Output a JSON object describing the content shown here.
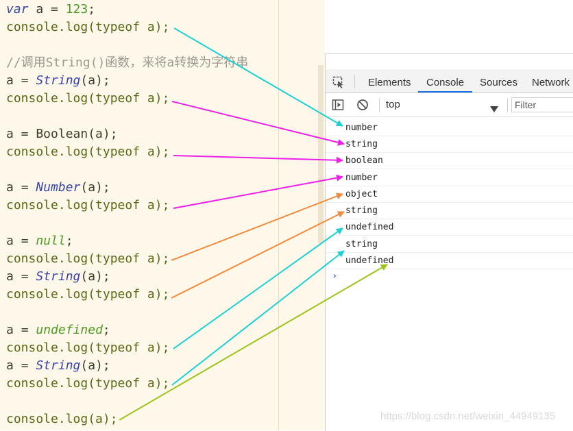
{
  "code": {
    "line1": {
      "kw": "var",
      "rest1": " a ",
      "op": "=",
      "num": " 123",
      "end": ";"
    },
    "line2": {
      "fn": "console.log(typeof a);"
    },
    "line3": {
      "comment": "//调用String()函数，来将a转换为字符串"
    },
    "line4": {
      "a": "a ",
      "eq": "= ",
      "cls": "String",
      "args": "(a);"
    },
    "line5": {
      "fn": "console.log(typeof a);"
    },
    "line6": {
      "text": "a = Boolean(a);"
    },
    "line7": {
      "fn": "console.log(typeof a);"
    },
    "line8": {
      "a": "a ",
      "eq": "= ",
      "cls": "Number",
      "args": "(a);"
    },
    "line9": {
      "fn": "console.log(typeof a);"
    },
    "line10": {
      "a": "a ",
      "eq": "= ",
      "kwv": "null",
      "end": ";"
    },
    "line11": {
      "fn": "console.log(typeof a);"
    },
    "line12": {
      "a": "a ",
      "eq": "= ",
      "cls": "String",
      "args": "(a);"
    },
    "line13": {
      "fn": "console.log(typeof a);"
    },
    "line14": {
      "a": "a ",
      "eq": "= ",
      "kwv": "undefined",
      "end": ";"
    },
    "line15": {
      "fn": "console.log(typeof a);"
    },
    "line16": {
      "a": "a ",
      "eq": "= ",
      "cls": "String",
      "args": "(a);"
    },
    "line17": {
      "fn": "console.log(typeof a);"
    },
    "line18": {
      "fn": "console.log(a);"
    }
  },
  "devtools": {
    "tabs": [
      "Elements",
      "Console",
      "Sources",
      "Network"
    ],
    "active_tab": "Console",
    "context": "top",
    "filter_placeholder": "Filter",
    "logs": [
      "number",
      "string",
      "boolean",
      "number",
      "object",
      "string",
      "undefined",
      "string",
      "undefined"
    ],
    "prompt": "›"
  },
  "watermark": "https://blog.csdn.net/weixin_44949135",
  "colors": {
    "cyan": "#1ed0d4",
    "magenta": "#ee1fe8",
    "orange": "#f08a3c",
    "lime": "#9cc41a",
    "accent": "#1a73e8"
  },
  "icons": [
    "inspect-icon",
    "sidebar-icon",
    "clear-icon",
    "dropdown-arrow-icon",
    "prompt-chevron-icon"
  ]
}
